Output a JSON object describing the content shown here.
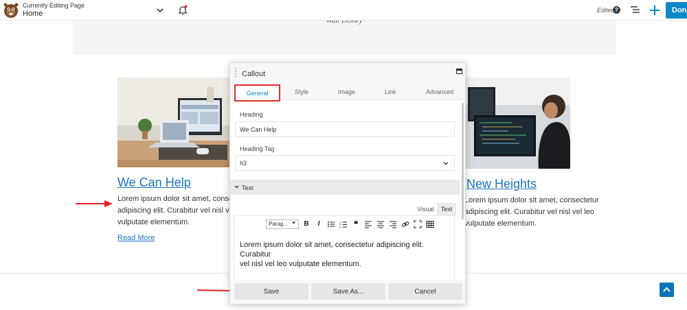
{
  "topbar": {
    "subtitle": "Currently Editing Page",
    "page_name": "Home",
    "status": "Edited",
    "help": "?",
    "done_label": "Done"
  },
  "quote": {
    "author": "Walt Disney"
  },
  "columns": [
    {
      "title": "We Can Help",
      "lines": [
        "Lorem ipsum dolor sit amet, consectetur",
        "adipiscing elit. Curabitur vel nisl vel leo",
        "vulputate elementum."
      ],
      "link": "Read More"
    },
    {
      "title": "New Heights",
      "lines": [
        "Lorem ipsum dolor sit amet, consectetur",
        "adipiscing elit. Curabitur vel nisl vel leo",
        "vulputate elementum."
      ]
    }
  ],
  "panel": {
    "title": "Callout",
    "tabs": [
      "General",
      "Style",
      "Image",
      "Link",
      "Advanced"
    ],
    "heading_label": "Heading",
    "heading_value": "We Can Help",
    "heading_tag_label": "Heading Tag",
    "heading_tag_value": "h3",
    "section_label": "Text",
    "editor_modes": [
      "Visual",
      "Text"
    ],
    "format_select": "Parag...",
    "editor_lines": [
      "Lorem ipsum dolor sit amet, consectetur adipiscing elit. Curabitur",
      "vel nisl vel leo vulputate elementum."
    ],
    "buttons": [
      "Save",
      "Save As...",
      "Cancel"
    ]
  },
  "colors": {
    "accent": "#0e87c8",
    "highlight": "#d9302c",
    "link": "#1a73c4"
  },
  "icons": [
    "chevron-down-icon",
    "bell-icon",
    "help-icon",
    "outline-icon",
    "plus-icon",
    "maximize-icon",
    "scroll-top-icon",
    "arrow-annotation-icon"
  ]
}
